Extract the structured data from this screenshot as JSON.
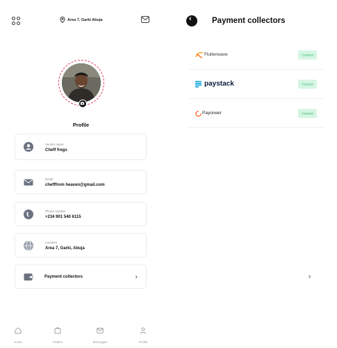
{
  "header": {
    "location": "Area 7, Garki Abuja"
  },
  "profile": {
    "title": "Profile"
  },
  "fields": [
    {
      "label": "Vendor name",
      "value": "Cheff fregs"
    },
    {
      "label": "Email",
      "value": "chefffrom heaven@gmail.com"
    },
    {
      "label": "Phone number",
      "value": "+234 901 540 6115"
    },
    {
      "label": "Location",
      "value": "Area 7, Garki, Abuja"
    }
  ],
  "payment_card": {
    "label": "Payment collectors"
  },
  "nav": [
    {
      "label": "Home"
    },
    {
      "label": "Orders"
    },
    {
      "label": "Messages"
    },
    {
      "label": "Profile"
    }
  ],
  "collectors": {
    "title": "Payment collectors",
    "providers": [
      {
        "name": "Flutterwave",
        "action": "Connect"
      },
      {
        "name": "paystack",
        "action": "Connect"
      },
      {
        "name": "Payoneer",
        "action": "Connect"
      }
    ]
  },
  "colors": {
    "accent_dark": "#111111",
    "connect_bg": "#d4f5e2",
    "connect_text": "#39b26c",
    "avatar_ring": "#e03a57",
    "icon_gray": "#6b7280",
    "paystack_blue": "#0aa5de",
    "flutterwave_orange": "#f5a623"
  }
}
